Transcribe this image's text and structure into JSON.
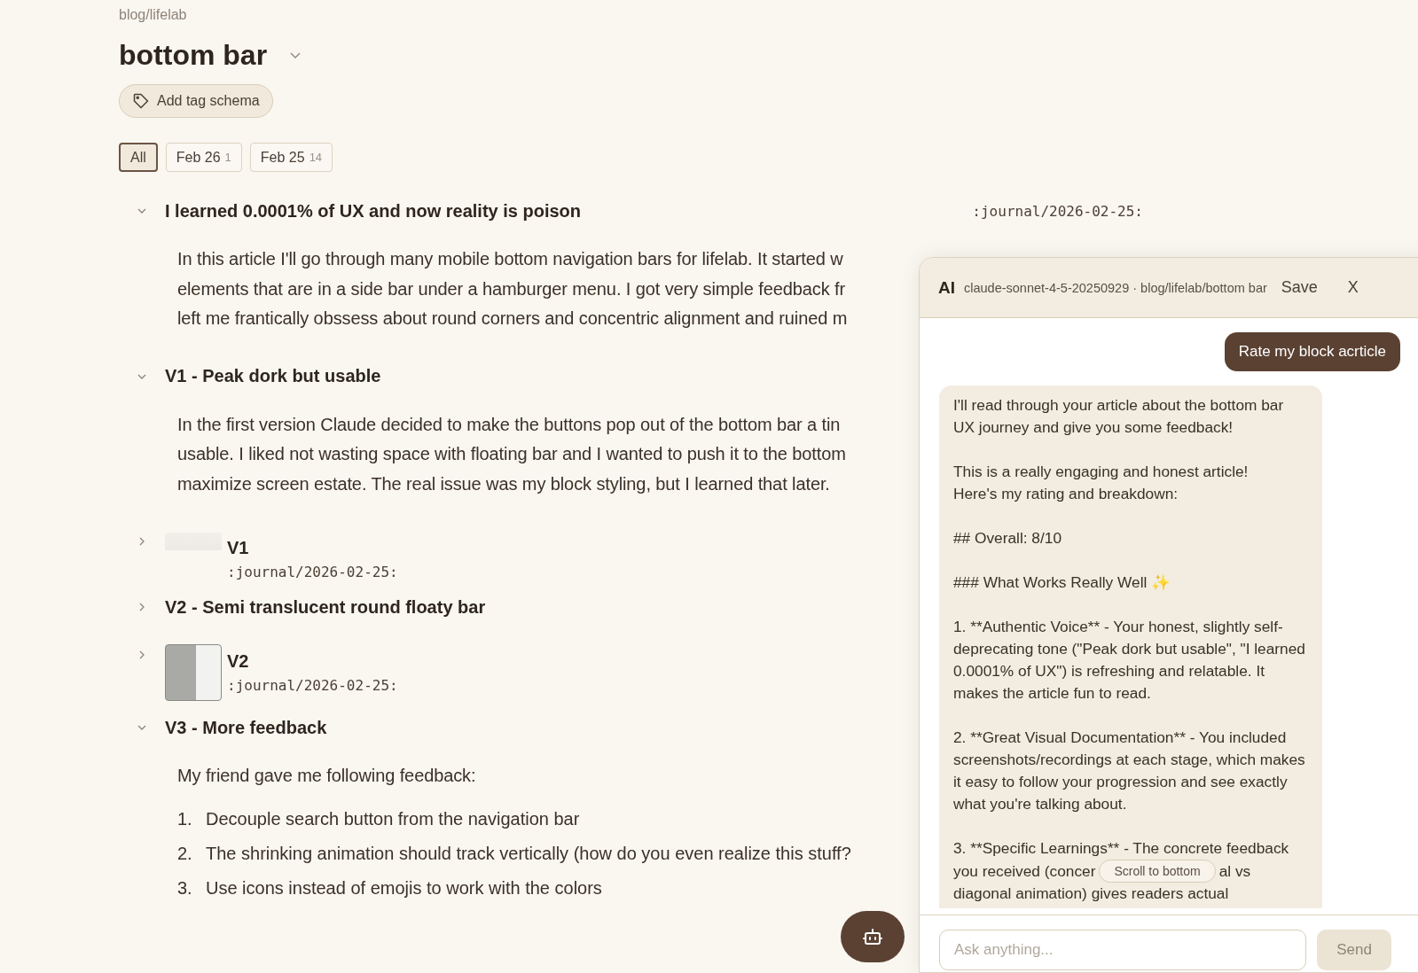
{
  "breadcrumb": "blog/lifelab",
  "title": "bottom bar",
  "tag_button": "Add tag schema",
  "filters": [
    {
      "label": "All",
      "selected": true
    },
    {
      "label": "Feb 26",
      "count": "1",
      "selected": false
    },
    {
      "label": "Feb 25",
      "count": "14",
      "selected": false
    }
  ],
  "blocks": [
    {
      "kind": "heading",
      "text": "I learned 0.0001% of UX and now reality is poison",
      "expanded": true,
      "ref": ":journal/2026-02-25:"
    },
    {
      "kind": "paragraph",
      "lines": [
        "In this article I'll go through many mobile bottom navigation bars for lifelab. It started w",
        "elements that are in a side bar under a hamburger menu. I got very simple feedback fr",
        "left me frantically obssess about round corners and concentric alignment and ruined m"
      ]
    },
    {
      "kind": "heading",
      "text": "V1 - Peak dork but usable",
      "expanded": true
    },
    {
      "kind": "paragraph",
      "lines": [
        "In the first version Claude decided to make the buttons pop out of the bottom bar a tin",
        "usable. I liked not wasting space with floating bar and I wanted to push it to the bottom",
        "maximize screen estate. The real issue was my block styling, but I learned that later."
      ]
    },
    {
      "kind": "faint_image",
      "label": "V1",
      "ref": ":journal/2026-02-25:",
      "expanded": false
    },
    {
      "kind": "heading",
      "text": "V2 - Semi translucent round floaty bar",
      "expanded": false
    },
    {
      "kind": "screenshot_image",
      "label": "V2",
      "ref": ":journal/2026-02-25:",
      "expanded": false
    },
    {
      "kind": "heading",
      "text": "V3 - More feedback",
      "expanded": true
    },
    {
      "kind": "paragraph",
      "lines": [
        "My friend gave me following feedback:"
      ]
    },
    {
      "kind": "list",
      "items": [
        {
          "marker": "1.",
          "text": "Decouple search button from the navigation bar"
        },
        {
          "marker": "2.",
          "text": "The shrinking animation should track vertically (how do you even realize this stuff?"
        },
        {
          "marker": "3.",
          "text": "Use icons instead of emojis to work with the colors"
        }
      ]
    }
  ],
  "chat": {
    "label": "AI",
    "meta": "claude-sonnet-4-5-20250929 · blog/lifelab/bottom bar",
    "save": "Save",
    "close": "X",
    "user_message": "Rate my block acrticle",
    "assistant_message": {
      "paragraphs": [
        "I'll read through your article about the bottom bar UX journey and give you some feedback!",
        "This is a really engaging and honest article!\nHere's my rating and breakdown:",
        "## Overall: 8/10",
        "### What Works Really Well ✨",
        "1. **Authentic Voice** - Your honest, slightly self-deprecating tone (\"Peak dork but usable\", \"I learned 0.0001% of UX\") is refreshing and relatable. It makes the article fun to read.",
        "2. **Great Visual Documentation** - You included screenshots/recordings at each stage, which makes it easy to follow your progression and see exactly what you're talking about."
      ],
      "covered": {
        "first": "3. **Specific Learnings** - The concrete feedback",
        "before": "you received (concer",
        "after": "al vs",
        "last": "diagonal animation) gives readers actual"
      }
    },
    "scroll_button": "Scroll to bottom",
    "input_placeholder": "Ask anything...",
    "send": "Send"
  }
}
